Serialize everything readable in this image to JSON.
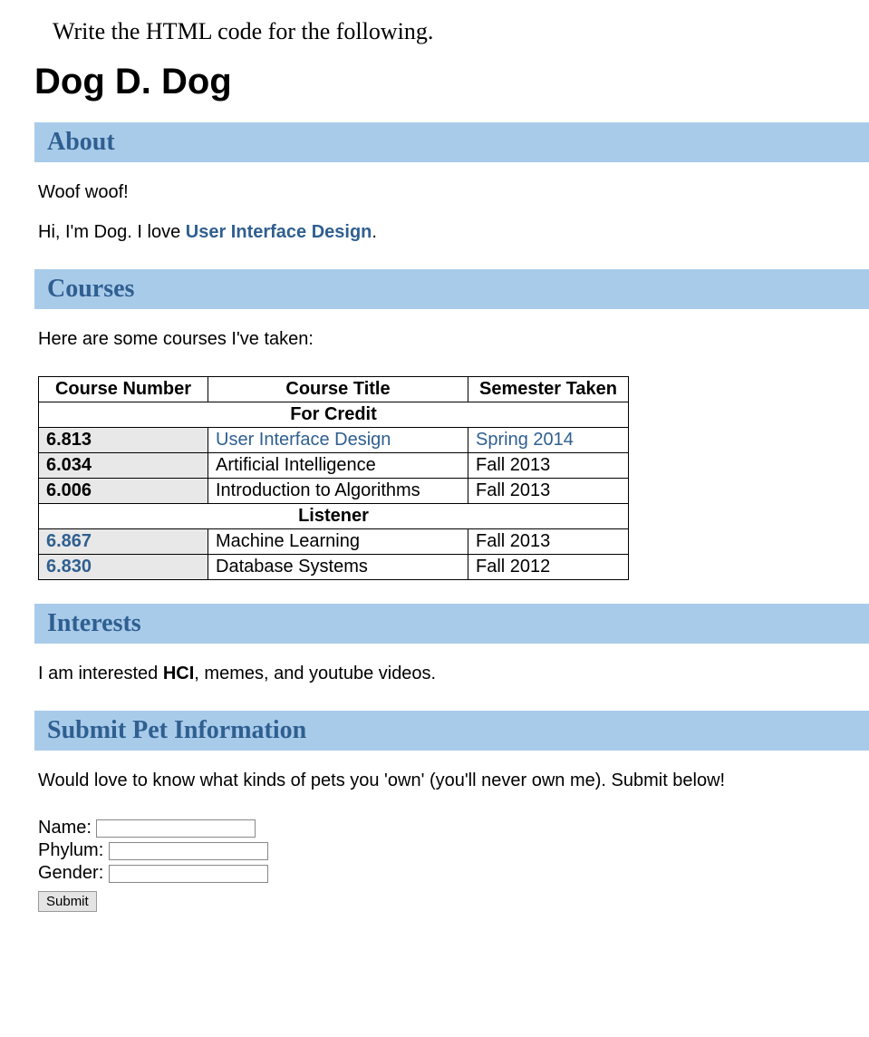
{
  "instruction": "Write the HTML code for the following.",
  "title": "Dog D. Dog",
  "sections": {
    "about": {
      "heading": "About",
      "line1": "Woof woof!",
      "line2_prefix": "Hi, I'm Dog. I love ",
      "line2_link": "User Interface Design",
      "line2_suffix": "."
    },
    "courses": {
      "heading": "Courses",
      "intro": "Here are some courses I've taken:",
      "headers": {
        "number": "Course Number",
        "title": "Course Title",
        "semester": "Semester Taken"
      },
      "groups": [
        {
          "label": "For Credit",
          "rows": [
            {
              "number": "6.813",
              "number_is_link": false,
              "title": "User Interface Design",
              "title_is_link": true,
              "semester": "Spring 2014",
              "semester_is_link": true
            },
            {
              "number": "6.034",
              "number_is_link": false,
              "title": "Artificial Intelligence",
              "title_is_link": false,
              "semester": "Fall 2013",
              "semester_is_link": false
            },
            {
              "number": "6.006",
              "number_is_link": false,
              "title": "Introduction to Algorithms",
              "title_is_link": false,
              "semester": "Fall 2013",
              "semester_is_link": false
            }
          ]
        },
        {
          "label": "Listener",
          "rows": [
            {
              "number": "6.867",
              "number_is_link": true,
              "title": "Machine Learning",
              "title_is_link": false,
              "semester": "Fall 2013",
              "semester_is_link": false
            },
            {
              "number": "6.830",
              "number_is_link": true,
              "title": "Database Systems",
              "title_is_link": false,
              "semester": "Fall 2012",
              "semester_is_link": false
            }
          ]
        }
      ]
    },
    "interests": {
      "heading": "Interests",
      "prefix": "I am interested ",
      "bold": "HCI",
      "suffix": ", memes, and youtube videos."
    },
    "submit": {
      "heading": "Submit Pet Information",
      "intro": "Would love to know what kinds of pets you 'own' (you'll never own me). Submit below!",
      "fields": {
        "name_label": "Name:",
        "phylum_label": "Phylum:",
        "gender_label": "Gender:"
      },
      "button": "Submit"
    }
  }
}
